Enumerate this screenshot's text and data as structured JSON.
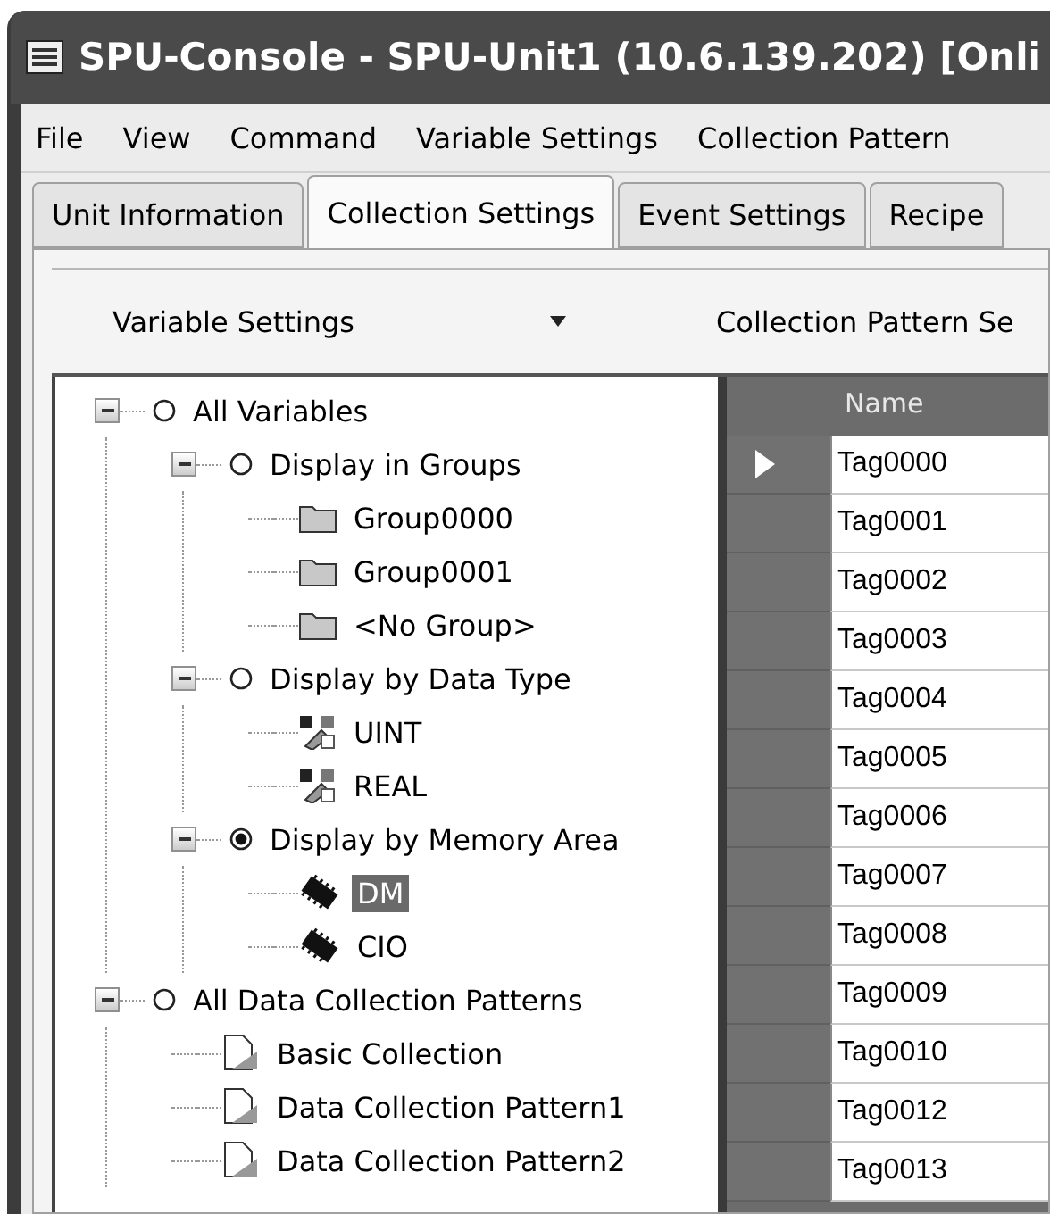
{
  "window": {
    "title": "SPU-Console - SPU-Unit1 (10.6.139.202) [Onli"
  },
  "menu": [
    {
      "label": "File"
    },
    {
      "label": "View"
    },
    {
      "label": "Command"
    },
    {
      "label": "Variable Settings"
    },
    {
      "label": "Collection Pattern"
    }
  ],
  "tabs": [
    {
      "label": "Unit Information",
      "selected": false
    },
    {
      "label": "Collection Settings",
      "selected": true
    },
    {
      "label": "Event Settings",
      "selected": false
    },
    {
      "label": "Recipe",
      "selected": false
    }
  ],
  "toolbar": {
    "variable_button": "Variable Settings",
    "pattern_button": "Collection Pattern Se"
  },
  "tree": [
    {
      "label": "All Variables",
      "kind": "radio",
      "selected": false,
      "expanded": true,
      "children": [
        {
          "label": "Display in Groups",
          "kind": "radio",
          "selected": false,
          "expanded": true,
          "children": [
            {
              "label": "Group0000",
              "kind": "folder",
              "selected": false
            },
            {
              "label": "Group0001",
              "kind": "folder",
              "selected": false
            },
            {
              "label": "<No Group>",
              "kind": "folder",
              "selected": false
            }
          ]
        },
        {
          "label": "Display by Data Type",
          "kind": "radio",
          "selected": false,
          "expanded": true,
          "children": [
            {
              "label": "UINT",
              "kind": "datatype",
              "selected": false
            },
            {
              "label": "REAL",
              "kind": "datatype",
              "selected": false
            }
          ]
        },
        {
          "label": "Display by Memory Area",
          "kind": "radio",
          "selected": true,
          "expanded": true,
          "children": [
            {
              "label": "DM",
              "kind": "chip",
              "selected": true
            },
            {
              "label": "CIO",
              "kind": "chip",
              "selected": false
            }
          ]
        }
      ]
    },
    {
      "label": "All Data Collection Patterns",
      "kind": "radio",
      "selected": false,
      "expanded": true,
      "children": [
        {
          "label": "Basic Collection",
          "kind": "document",
          "selected": false
        },
        {
          "label": "Data Collection Pattern1",
          "kind": "document",
          "selected": false
        },
        {
          "label": "Data Collection Pattern2",
          "kind": "document",
          "selected": false
        }
      ]
    }
  ],
  "grid": {
    "columns": [
      "Name"
    ],
    "rows": [
      {
        "name": "Tag0000",
        "current": true
      },
      {
        "name": "Tag0001",
        "current": false
      },
      {
        "name": "Tag0002",
        "current": false
      },
      {
        "name": "Tag0003",
        "current": false
      },
      {
        "name": "Tag0004",
        "current": false
      },
      {
        "name": "Tag0005",
        "current": false
      },
      {
        "name": "Tag0006",
        "current": false
      },
      {
        "name": "Tag0007",
        "current": false
      },
      {
        "name": "Tag0008",
        "current": false
      },
      {
        "name": "Tag0009",
        "current": false
      },
      {
        "name": "Tag0010",
        "current": false
      },
      {
        "name": "Tag0012",
        "current": false
      },
      {
        "name": "Tag0013",
        "current": false
      }
    ]
  }
}
